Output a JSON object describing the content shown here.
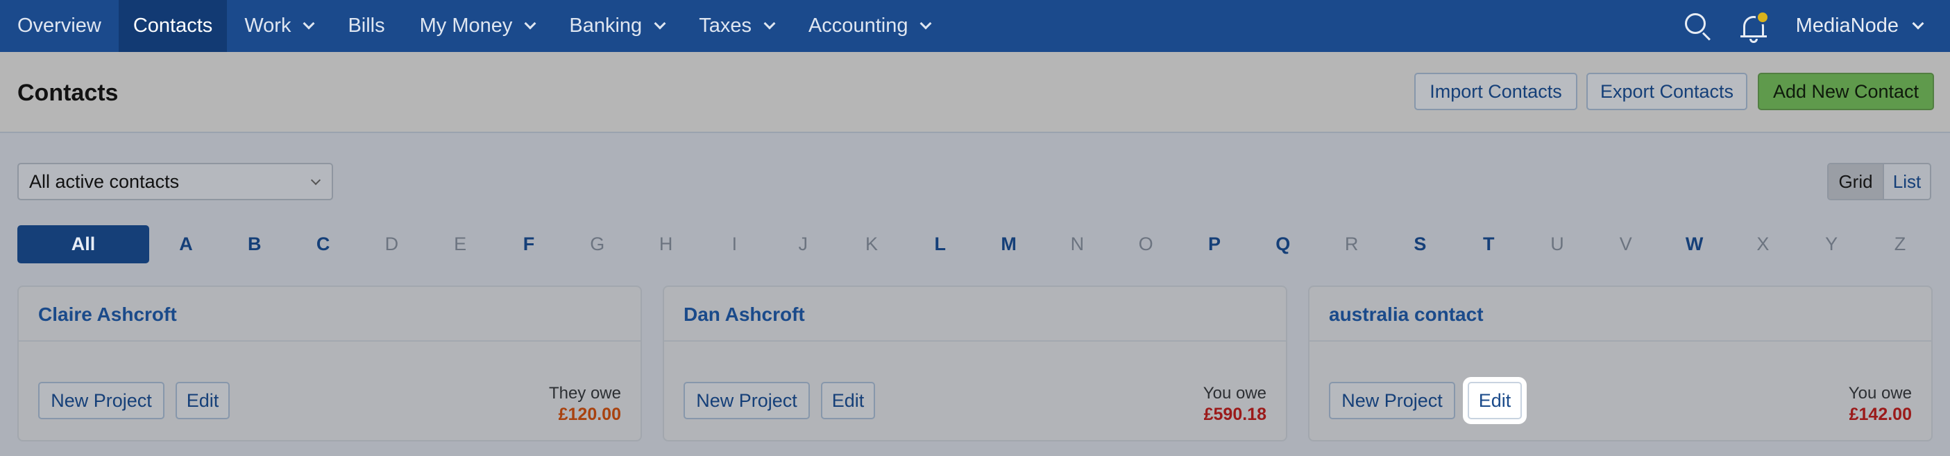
{
  "nav": {
    "items": [
      {
        "label": "Overview",
        "dropdown": false,
        "active": false
      },
      {
        "label": "Contacts",
        "dropdown": false,
        "active": true
      },
      {
        "label": "Work",
        "dropdown": true,
        "active": false
      },
      {
        "label": "Bills",
        "dropdown": false,
        "active": false
      },
      {
        "label": "My Money",
        "dropdown": true,
        "active": false
      },
      {
        "label": "Banking",
        "dropdown": true,
        "active": false
      },
      {
        "label": "Taxes",
        "dropdown": true,
        "active": false
      },
      {
        "label": "Accounting",
        "dropdown": true,
        "active": false
      }
    ],
    "account_name": "MediaNode",
    "search_icon": "search-icon",
    "notifications_icon": "bell-icon"
  },
  "header": {
    "title": "Contacts",
    "import_label": "Import Contacts",
    "export_label": "Export Contacts",
    "add_label": "Add New Contact"
  },
  "filter": {
    "selected": "All active contacts"
  },
  "view_toggle": {
    "grid_label": "Grid",
    "list_label": "List",
    "active": "Grid"
  },
  "letters": {
    "all_label": "All",
    "items": [
      {
        "letter": "A",
        "has_contacts": true
      },
      {
        "letter": "B",
        "has_contacts": true
      },
      {
        "letter": "C",
        "has_contacts": true
      },
      {
        "letter": "D",
        "has_contacts": false
      },
      {
        "letter": "E",
        "has_contacts": false
      },
      {
        "letter": "F",
        "has_contacts": true
      },
      {
        "letter": "G",
        "has_contacts": false
      },
      {
        "letter": "H",
        "has_contacts": false
      },
      {
        "letter": "I",
        "has_contacts": false
      },
      {
        "letter": "J",
        "has_contacts": false
      },
      {
        "letter": "K",
        "has_contacts": false
      },
      {
        "letter": "L",
        "has_contacts": true
      },
      {
        "letter": "M",
        "has_contacts": true
      },
      {
        "letter": "N",
        "has_contacts": false
      },
      {
        "letter": "O",
        "has_contacts": false
      },
      {
        "letter": "P",
        "has_contacts": true
      },
      {
        "letter": "Q",
        "has_contacts": true
      },
      {
        "letter": "R",
        "has_contacts": false
      },
      {
        "letter": "S",
        "has_contacts": true
      },
      {
        "letter": "T",
        "has_contacts": true
      },
      {
        "letter": "U",
        "has_contacts": false
      },
      {
        "letter": "V",
        "has_contacts": false
      },
      {
        "letter": "W",
        "has_contacts": true
      },
      {
        "letter": "X",
        "has_contacts": false
      },
      {
        "letter": "Y",
        "has_contacts": false
      },
      {
        "letter": "Z",
        "has_contacts": false
      }
    ]
  },
  "cards": [
    {
      "name": "Claire Ashcroft",
      "new_project_label": "New Project",
      "edit_label": "Edit",
      "owe_label": "They owe",
      "amount": "£120.00",
      "amount_color": "#a8420f"
    },
    {
      "name": "Dan Ashcroft",
      "new_project_label": "New Project",
      "edit_label": "Edit",
      "owe_label": "You owe",
      "amount": "£590.18",
      "amount_color": "#9b1a1a"
    },
    {
      "name": "australia contact",
      "new_project_label": "New Project",
      "edit_label": "Edit",
      "owe_label": "You owe",
      "amount": "£142.00",
      "amount_color": "#9b1a1a"
    }
  ],
  "colors": {
    "nav_bg": "#1b4a8c",
    "accent": "#153f78",
    "primary_button": "#5f9a4c"
  }
}
